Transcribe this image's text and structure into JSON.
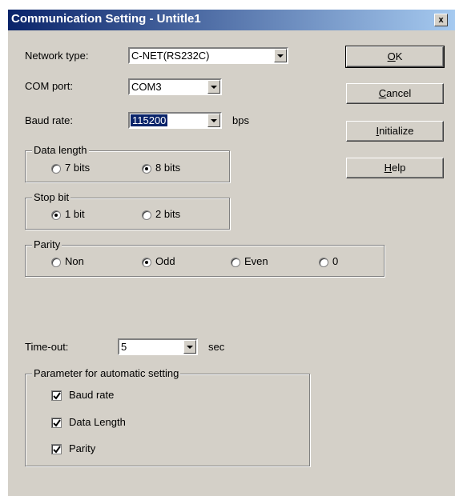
{
  "title": "Communication Setting - Untitle1",
  "close_label": "x",
  "fields": {
    "network_type": {
      "label": "Network type:",
      "value": "C-NET(RS232C)"
    },
    "com_port": {
      "label": "COM port:",
      "value": "COM3"
    },
    "baud_rate": {
      "label": "Baud rate:",
      "value": "115200",
      "unit": "bps"
    },
    "timeout": {
      "label": "Time-out:",
      "value": "5",
      "unit": "sec"
    }
  },
  "buttons": {
    "ok": {
      "accel": "O",
      "rest": "K"
    },
    "cancel": {
      "accel": "C",
      "rest": "ancel"
    },
    "initialize": {
      "accel": "I",
      "rest": "nitialize"
    },
    "help": {
      "accel": "H",
      "rest": "elp"
    }
  },
  "data_length": {
    "legend": "Data length",
    "options": [
      "7 bits",
      "8 bits"
    ],
    "selected": "8 bits"
  },
  "stop_bit": {
    "legend": "Stop bit",
    "options": [
      "1 bit",
      "2 bits"
    ],
    "selected": "1 bit"
  },
  "parity": {
    "legend": "Parity",
    "options": [
      "Non",
      "Odd",
      "Even",
      "0"
    ],
    "selected": "Odd"
  },
  "auto_setting": {
    "legend": "Parameter for automatic setting",
    "items": [
      {
        "label": "Baud rate",
        "checked": true
      },
      {
        "label": "Data Length",
        "checked": true
      },
      {
        "label": "Parity",
        "checked": true
      }
    ]
  }
}
